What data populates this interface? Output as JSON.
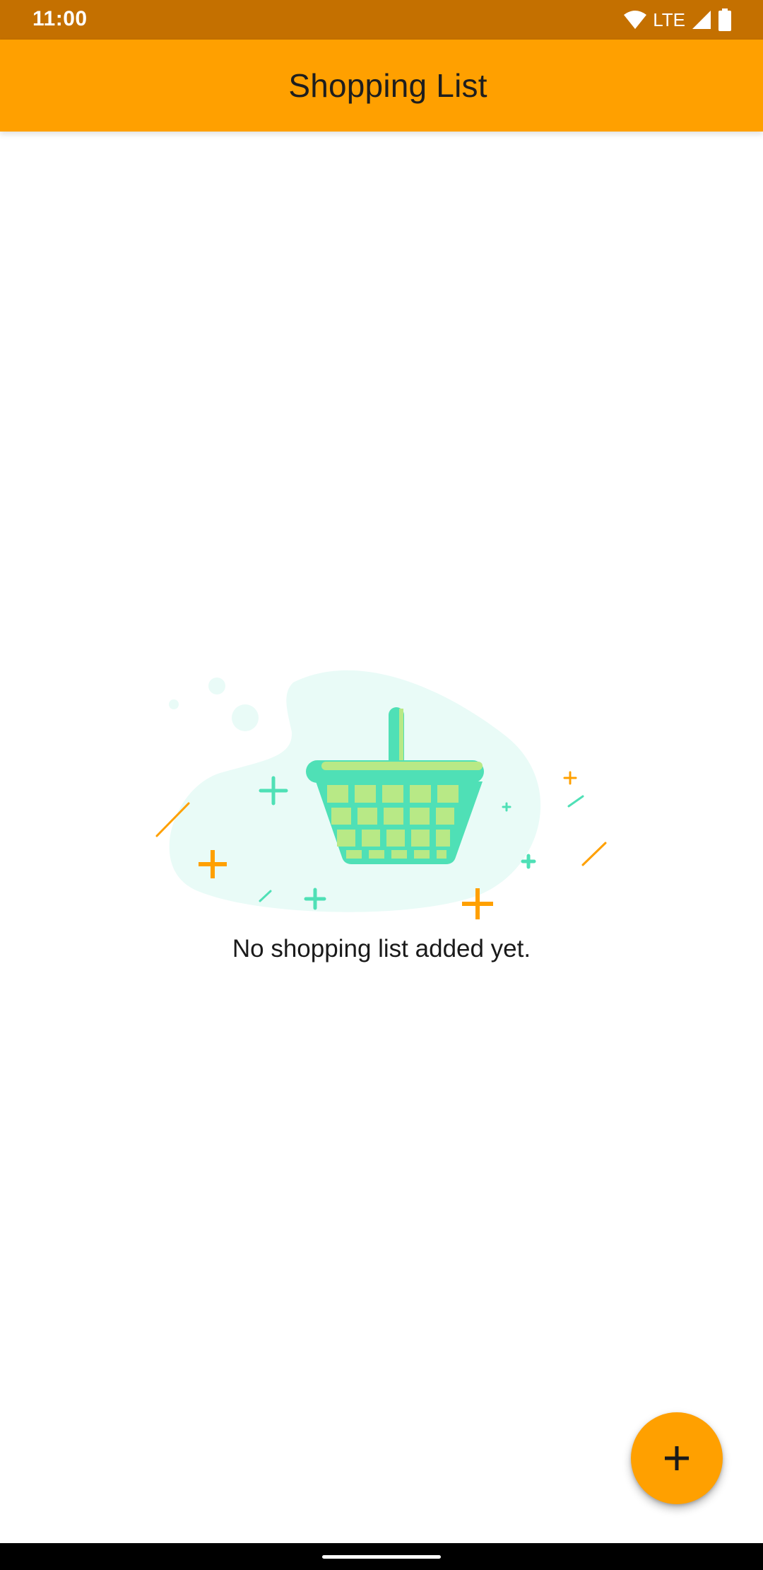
{
  "status_bar": {
    "time": "11:00",
    "network": "LTE",
    "icons": [
      "wifi-icon",
      "signal-icon",
      "battery-icon"
    ]
  },
  "app_bar": {
    "title": "Shopping List",
    "background": "#ffa000"
  },
  "empty_state": {
    "illustration": "shopping-basket-icon",
    "message": "No shopping list added yet."
  },
  "fab": {
    "icon": "plus-icon",
    "color": "#ffa000"
  },
  "colors": {
    "status_bar": "#c47000",
    "accent": "#ffa000",
    "basket_teal": "#4fe0b6",
    "basket_green": "#b8e986",
    "blob": "#e9fbf7"
  }
}
